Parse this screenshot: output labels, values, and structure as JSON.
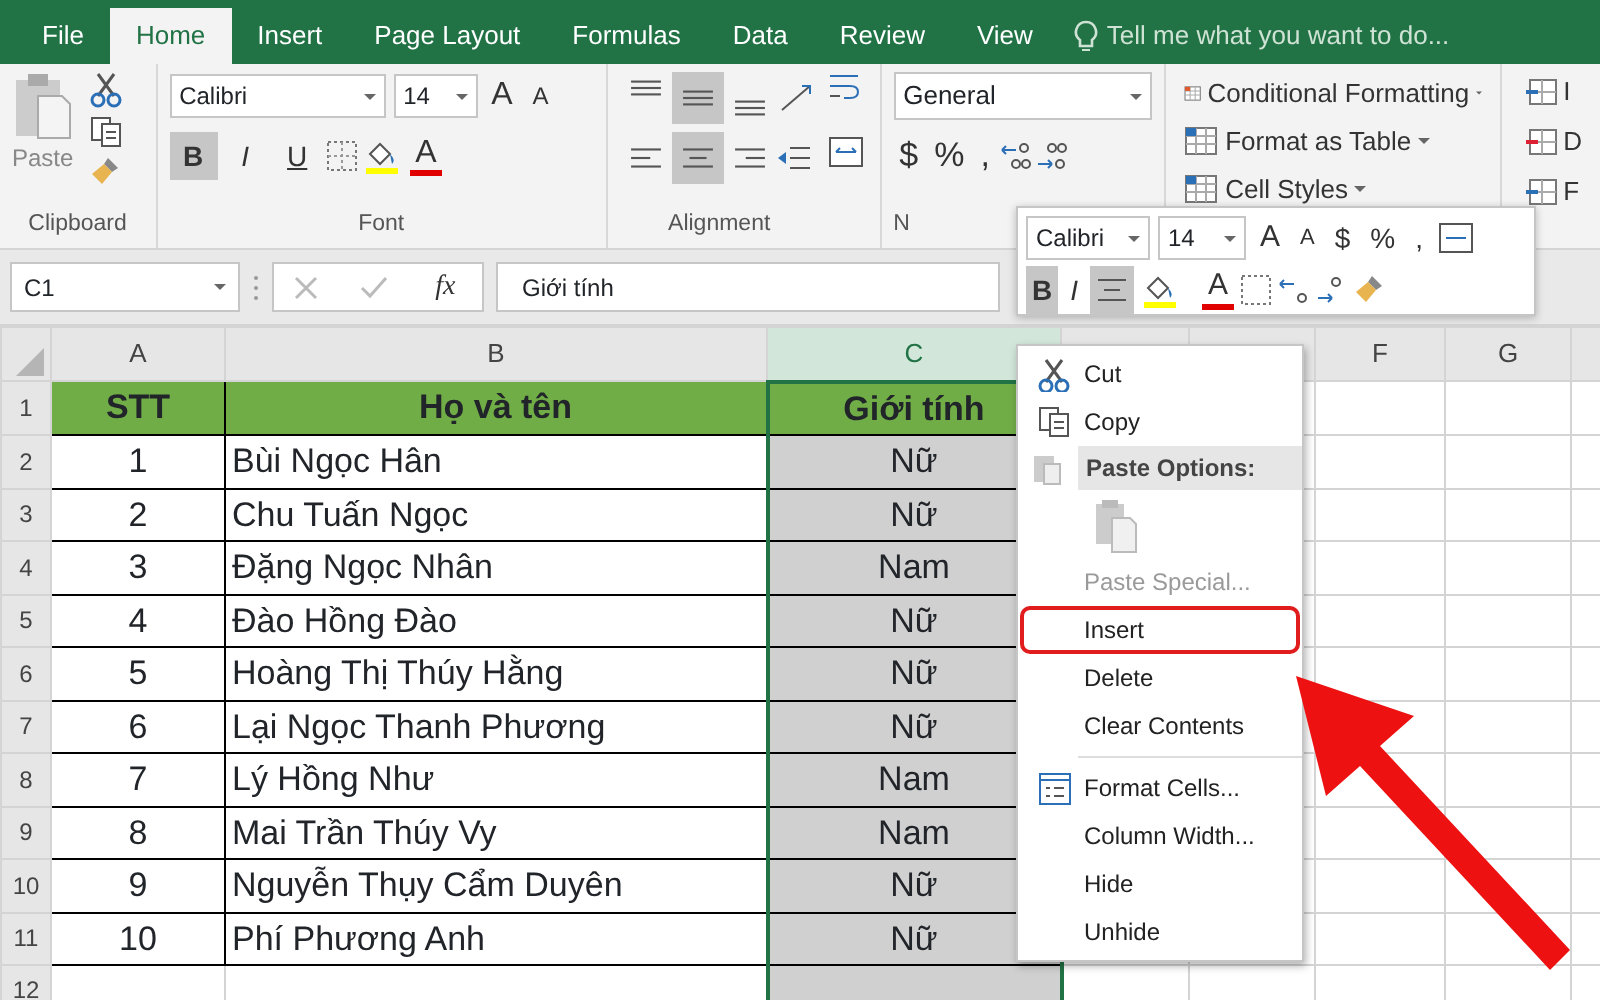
{
  "tabs": [
    {
      "label": "File",
      "selected": false
    },
    {
      "label": "Home",
      "selected": true
    },
    {
      "label": "Insert",
      "selected": false
    },
    {
      "label": "Page Layout",
      "selected": false
    },
    {
      "label": "Formulas",
      "selected": false
    },
    {
      "label": "Data",
      "selected": false
    },
    {
      "label": "Review",
      "selected": false
    },
    {
      "label": "View",
      "selected": false
    }
  ],
  "tell_me": {
    "placeholder": "Tell me what you want to do..."
  },
  "ribbon": {
    "clipboard": {
      "paste": "Paste",
      "group": "Clipboard"
    },
    "font": {
      "name": "Calibri",
      "size": "14",
      "grow": "A",
      "shrink": "A",
      "styles": [
        {
          "label": "B",
          "selected": true
        },
        {
          "label": "I",
          "selected": false
        },
        {
          "label": "U",
          "selected": false
        }
      ],
      "color_label": "A",
      "group": "Font"
    },
    "alignment": {
      "vertical": [
        {
          "selected": false
        },
        {
          "selected": true
        },
        {
          "selected": false
        }
      ],
      "horizontal": [
        {
          "selected": false
        },
        {
          "selected": true
        },
        {
          "selected": false
        }
      ],
      "group": "Alignment"
    },
    "number": {
      "format": "General",
      "symbols": [
        "$",
        "%",
        ","
      ],
      "group": "N"
    },
    "styles": {
      "items": [
        "Conditional Formatting",
        "Format as Table",
        "Cell Styles"
      ]
    },
    "cells": {
      "items": [
        "I",
        "D",
        "F"
      ]
    }
  },
  "formula_bar": {
    "name_box": "C1",
    "fx": "fx",
    "value": "Giới tính"
  },
  "sheet": {
    "columns": [
      {
        "label": "A",
        "selected": false
      },
      {
        "label": "B",
        "selected": false
      },
      {
        "label": "C",
        "selected": true
      },
      {
        "selected": false
      },
      {
        "selected": false
      },
      {
        "label": "F",
        "selected": false
      },
      {
        "label": "G",
        "selected": false
      },
      {
        "selected": false
      }
    ],
    "row_numbers": [
      "1",
      "2",
      "3",
      "4",
      "5",
      "6",
      "7",
      "8",
      "9",
      "10",
      "11",
      "12"
    ],
    "header": [
      "STT",
      "Họ và tên",
      "Giới tính"
    ],
    "rows": [
      [
        "1",
        "Bùi Ngọc Hân",
        "Nữ"
      ],
      [
        "2",
        "Chu Tuấn Ngọc",
        "Nữ"
      ],
      [
        "3",
        "Đặng Ngọc Nhân",
        "Nam"
      ],
      [
        "4",
        "Đào Hồng Đào",
        "Nữ"
      ],
      [
        "5",
        "Hoàng Thị Thúy Hằng",
        "Nữ"
      ],
      [
        "6",
        "Lại Ngọc Thanh Phương",
        "Nữ"
      ],
      [
        "7",
        "Lý Hồng Như",
        "Nam"
      ],
      [
        "8",
        "Mai Trần Thúy Vy",
        "Nam"
      ],
      [
        "9",
        "Nguyễn Thụy Cẩm Duyên",
        "Nữ"
      ],
      [
        "10",
        "Phí Phương Anh",
        "Nữ"
      ]
    ]
  },
  "mini_toolbar": {
    "font": "Calibri",
    "size": "14",
    "grow": "A",
    "shrink": "A",
    "symbols": [
      "$",
      "%",
      ","
    ],
    "bold": {
      "label": "B",
      "selected": true
    },
    "italic": {
      "label": "I",
      "selected": false
    },
    "center_selected": true,
    "color_label": "A"
  },
  "context_menu": [
    {
      "kind": "command",
      "label": "Cut",
      "disabled": false,
      "highlighted": false
    },
    {
      "kind": "command",
      "label": "Copy",
      "disabled": false,
      "highlighted": false
    },
    {
      "kind": "header",
      "label": "Paste Options:"
    },
    {
      "kind": "paste-icon"
    },
    {
      "kind": "command",
      "label": "Paste Special...",
      "disabled": true,
      "highlighted": false
    },
    {
      "kind": "command",
      "label": "Insert",
      "disabled": false,
      "highlighted": true
    },
    {
      "kind": "command",
      "label": "Delete",
      "disabled": false,
      "highlighted": false
    },
    {
      "kind": "command",
      "label": "Clear Contents",
      "disabled": false,
      "highlighted": false
    },
    {
      "kind": "separator"
    },
    {
      "kind": "command",
      "label": "Format Cells...",
      "disabled": false,
      "highlighted": false
    },
    {
      "kind": "command",
      "label": "Column Width...",
      "disabled": false,
      "highlighted": false
    },
    {
      "kind": "command",
      "label": "Hide",
      "disabled": false,
      "highlighted": false
    },
    {
      "kind": "command",
      "label": "Unhide",
      "disabled": false,
      "highlighted": false
    }
  ]
}
